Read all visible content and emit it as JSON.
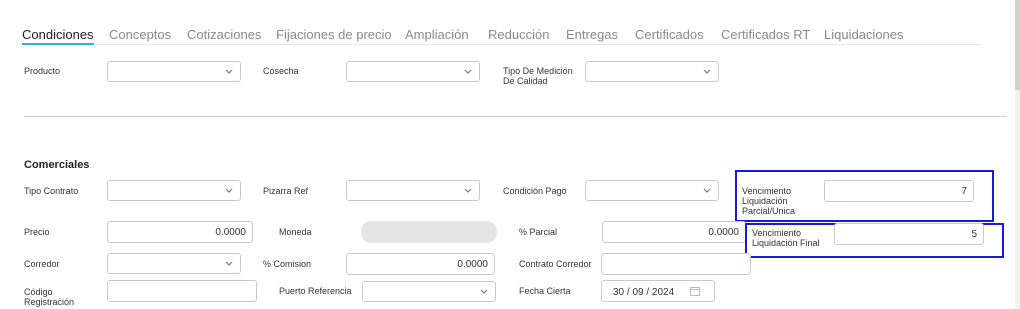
{
  "tabs": [
    {
      "label": "Condiciones",
      "active": true
    },
    {
      "label": "Conceptos",
      "active": false
    },
    {
      "label": "Cotizaciones",
      "active": false
    },
    {
      "label": "Fijaciones de precio",
      "active": false
    },
    {
      "label": "Ampliación",
      "active": false
    },
    {
      "label": "Reducción",
      "active": false
    },
    {
      "label": "Entregas",
      "active": false
    },
    {
      "label": "Certificados",
      "active": false
    },
    {
      "label": "Certificados RT",
      "active": false
    },
    {
      "label": "Liquidaciones",
      "active": false
    }
  ],
  "accent_color": "#29b6c9",
  "highlight_color": "#1a1ad6",
  "top_row": {
    "producto_label": "Producto",
    "cosecha_label": "Cosecha",
    "tipo_medicion_label_1": "Tipo De Medición",
    "tipo_medicion_label_2": "De Calidad"
  },
  "comerciales": {
    "title": "Comerciales",
    "tipo_contrato_label": "Tipo Contrato",
    "pizarra_ref_label": "Pizarra Ref",
    "condicion_pago_label": "Condición Pago",
    "venc_parcial_label_1": "Vencimiento",
    "venc_parcial_label_2": "Liquidación",
    "venc_parcial_label_3": "Parcial/Unica",
    "venc_parcial_value": "7",
    "precio_label": "Precio",
    "precio_value": "0.0000",
    "moneda_label": "Moneda",
    "parcial_label": "% Parcial",
    "parcial_value": "0.0000",
    "venc_final_label_1": "Vencimiento",
    "venc_final_label_2": "Liquidación Final",
    "venc_final_value": "5",
    "corredor_label": "Corredor",
    "comision_label": "% Comision",
    "comision_value": "0.0000",
    "contrato_corredor_label": "Contrato Corredor",
    "codigo_label_1": "Código",
    "codigo_label_2": "Registración",
    "puerto_label": "Puerto Referencia",
    "fecha_label": "Fecha Cierta",
    "fecha_value": "30 / 09 / 2024"
  },
  "icons": {
    "dropdown": "chevron-down-icon",
    "calendar": "calendar-icon"
  }
}
